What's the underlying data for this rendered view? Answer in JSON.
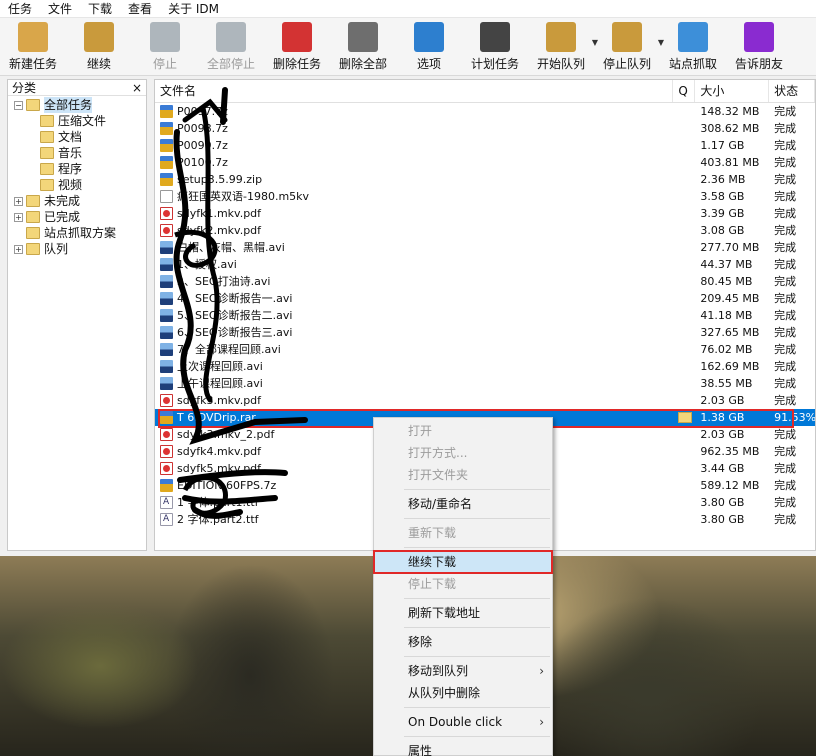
{
  "menubar": [
    "任务",
    "文件",
    "下载",
    "查看",
    "关于 IDM"
  ],
  "toolbar": [
    {
      "label": "新建任务",
      "icon": "new-task-icon",
      "color": "#d9a64a",
      "enabled": true
    },
    {
      "label": "继续",
      "icon": "resume-icon",
      "color": "#c99a3c",
      "enabled": true
    },
    {
      "label": "停止",
      "icon": "stop-icon",
      "color": "#7f8c96",
      "enabled": false
    },
    {
      "label": "全部停止",
      "icon": "stop-all-icon",
      "color": "#7f8c96",
      "enabled": false
    },
    {
      "label": "删除任务",
      "icon": "delete-task-icon",
      "color": "#d33333",
      "enabled": true
    },
    {
      "label": "删除全部",
      "icon": "delete-all-icon",
      "color": "#6e6e6e",
      "enabled": true
    },
    {
      "label": "选项",
      "icon": "options-icon",
      "color": "#2d7fcf",
      "enabled": true
    },
    {
      "label": "计划任务",
      "icon": "scheduler-icon",
      "color": "#444444",
      "enabled": true
    },
    {
      "label": "开始队列",
      "icon": "start-queue-icon",
      "color": "#c99a3c",
      "enabled": true,
      "dropdown": true
    },
    {
      "label": "停止队列",
      "icon": "stop-queue-icon",
      "color": "#c99a3c",
      "enabled": true,
      "dropdown": true
    },
    {
      "label": "站点抓取",
      "icon": "site-grabber-icon",
      "color": "#3d8fd9",
      "enabled": true
    },
    {
      "label": "告诉朋友",
      "icon": "tell-friend-icon",
      "color": "#8a2bd0",
      "enabled": true
    }
  ],
  "sidebar": {
    "header": "分类",
    "close": "×",
    "tree": [
      {
        "label": "全部任务",
        "level": 0,
        "exp": "−",
        "selected": true
      },
      {
        "label": "压缩文件",
        "level": 1
      },
      {
        "label": "文档",
        "level": 1
      },
      {
        "label": "音乐",
        "level": 1
      },
      {
        "label": "程序",
        "level": 1
      },
      {
        "label": "视频",
        "level": 1
      },
      {
        "label": "未完成",
        "level": 0,
        "exp": "+"
      },
      {
        "label": "已完成",
        "level": 0,
        "exp": "+"
      },
      {
        "label": "站点抓取方案",
        "level": 0
      },
      {
        "label": "队列",
        "level": 0,
        "exp": "+"
      }
    ]
  },
  "list": {
    "headers": {
      "name": "文件名",
      "q": "Q",
      "size": "大小",
      "status": "状态"
    },
    "rows": [
      {
        "name": "P0097.7z",
        "type": "arch",
        "size": "148.32 MB",
        "status": "完成"
      },
      {
        "name": "P0098.7z",
        "type": "arch",
        "size": "308.62 MB",
        "status": "完成"
      },
      {
        "name": "P0099.7z",
        "type": "arch",
        "size": "1.17 GB",
        "status": "完成"
      },
      {
        "name": "P0100.7z",
        "type": "arch",
        "size": "403.81 MB",
        "status": "完成"
      },
      {
        "name": "setup3.5.99.zip",
        "type": "zip",
        "size": "2.36 MB",
        "status": "完成"
      },
      {
        "name": "    疯狂国英双语-1980.m5kv",
        "type": "blank",
        "size": "3.58 GB",
        "status": "完成"
      },
      {
        "name": "sdyfk1.mkv.pdf",
        "type": "pdf",
        "size": "3.39 GB",
        "status": "完成"
      },
      {
        "name": "sdyfk2.mkv.pdf",
        "type": "pdf",
        "size": "3.08 GB",
        "status": "完成"
      },
      {
        "name": "白帽、灰帽、黑帽.avi",
        "type": "avi",
        "size": "277.70 MB",
        "status": "完成"
      },
      {
        "name": "1、授权.avi",
        "type": "avi",
        "size": "44.37 MB",
        "status": "完成"
      },
      {
        "name": "2、SEO打油诗.avi",
        "type": "avi",
        "size": "80.45 MB",
        "status": "完成"
      },
      {
        "name": "4、SEO诊断报告一.avi",
        "type": "avi",
        "size": "209.45 MB",
        "status": "完成"
      },
      {
        "name": "5、SEO诊断报告二.avi",
        "type": "avi",
        "size": "41.18 MB",
        "status": "完成"
      },
      {
        "name": "6、SEO诊断报告三.avi",
        "type": "avi",
        "size": "327.65 MB",
        "status": "完成"
      },
      {
        "name": "7、全部课程回顾.avi",
        "type": "avi",
        "size": "76.02 MB",
        "status": "完成"
      },
      {
        "name": "上次课程回顾.avi",
        "type": "avi",
        "size": "162.69 MB",
        "status": "完成"
      },
      {
        "name": "上午课程回顾.avi",
        "type": "avi",
        "size": "38.55 MB",
        "status": "完成"
      },
      {
        "name": "sdyfk3.mkv.pdf",
        "type": "pdf",
        "size": "2.03 GB",
        "status": "完成"
      },
      {
        "name": "T                   6.DVDrip.rar",
        "type": "arch",
        "size": "1.38 GB",
        "status": "91.53%",
        "selected": true
      },
      {
        "name": "sdyfk3.mkv_2.pdf",
        "type": "pdf",
        "size": "2.03 GB",
        "status": "完成"
      },
      {
        "name": "sdyfk4.mkv.pdf",
        "type": "pdf",
        "size": "962.35 MB",
        "status": "完成"
      },
      {
        "name": "sdyfk5.mkv.pdf",
        "type": "pdf",
        "size": "3.44 GB",
        "status": "完成"
      },
      {
        "name": "      EDITION 60FPS.7z",
        "type": "arch",
        "size": "589.12 MB",
        "status": "完成"
      },
      {
        "name": "1   字体.part1.ttf",
        "type": "ttf",
        "size": "3.80 GB",
        "status": "完成"
      },
      {
        "name": "2   字体.part2.ttf",
        "type": "ttf",
        "size": "3.80 GB",
        "status": "完成"
      }
    ]
  },
  "context_menu": [
    {
      "label": "打开",
      "disabled": true
    },
    {
      "label": "打开方式...",
      "disabled": true
    },
    {
      "label": "打开文件夹",
      "disabled": true
    },
    {
      "sep": true
    },
    {
      "label": "移动/重命名"
    },
    {
      "sep": true
    },
    {
      "label": "重新下载",
      "disabled": true
    },
    {
      "sep": true
    },
    {
      "label": "继续下载",
      "highlight": true
    },
    {
      "label": "停止下载",
      "disabled": true
    },
    {
      "sep": true
    },
    {
      "label": "刷新下载地址"
    },
    {
      "sep": true
    },
    {
      "label": "移除"
    },
    {
      "sep": true
    },
    {
      "label": "移动到队列",
      "submenu": true
    },
    {
      "label": "从队列中删除"
    },
    {
      "sep": true
    },
    {
      "label": "On Double click",
      "submenu": true
    },
    {
      "sep": true
    },
    {
      "label": "属性"
    }
  ]
}
